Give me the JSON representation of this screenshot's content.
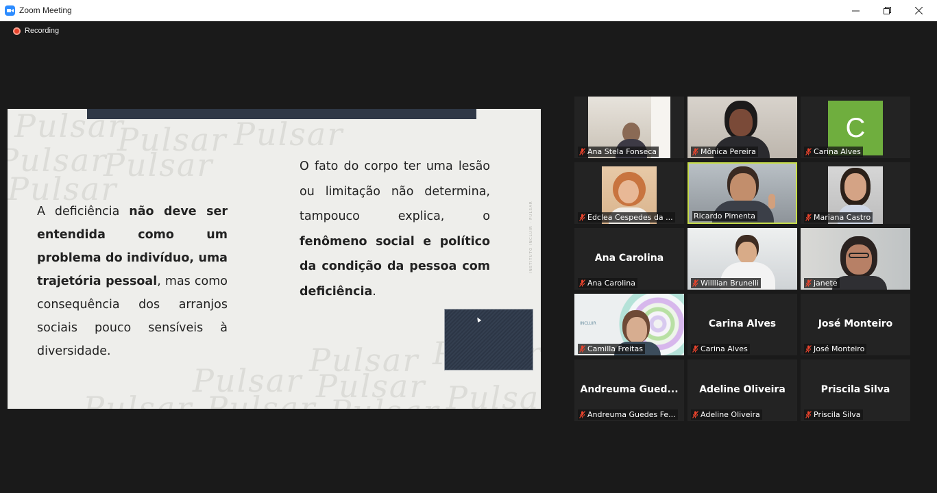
{
  "window": {
    "title": "Zoom Meeting",
    "icon": "zoom-camera-icon",
    "controls": [
      "minimize-icon",
      "restore-icon",
      "close-icon"
    ]
  },
  "recording": {
    "label": "Recording",
    "color": "#e8432c"
  },
  "slide": {
    "watermark": "Pulsar",
    "vertical_text": "INSTITUTO INCLUIR · PULSAR",
    "left_paragraph": [
      {
        "text": "A deficiência ",
        "bold": false
      },
      {
        "text": "não deve ser entendida como um problema do indivíduo, uma trajetória pessoal",
        "bold": true
      },
      {
        "text": ", mas como consequência dos arranjos sociais pouco sensíveis à diversidade.",
        "bold": false
      }
    ],
    "right_paragraph": [
      {
        "text": "O fato do corpo ter uma lesão ou limitação não determina, tampouco explica, o ",
        "bold": false
      },
      {
        "text": "fenômeno social e político da condição da pessoa com deficiência",
        "bold": true
      },
      {
        "text": ".",
        "bold": false
      }
    ]
  },
  "participants": [
    {
      "label": "Ana Stela Fonseca",
      "muted": true,
      "video": true,
      "active": false
    },
    {
      "label": "Mônica Pereira",
      "muted": true,
      "video": true,
      "active": false
    },
    {
      "label": "Carina Alves",
      "muted": true,
      "video": false,
      "avatar_letter": "C",
      "avatar_color": "#6fae3e",
      "active": false
    },
    {
      "label": "Edclea Cespedes da ...",
      "muted": true,
      "video": true,
      "active": false
    },
    {
      "label": "Ricardo Pimenta",
      "muted": false,
      "video": true,
      "active": true
    },
    {
      "label": "Mariana Castro",
      "muted": true,
      "video": true,
      "active": false
    },
    {
      "label": "Ana Carolina",
      "display_name": "Ana Carolina",
      "muted": true,
      "video": false,
      "active": false
    },
    {
      "label": "Willlian Brunelli",
      "muted": true,
      "video": true,
      "active": false
    },
    {
      "label": "janete",
      "muted": true,
      "video": true,
      "active": false
    },
    {
      "label": "Camilla Freitas",
      "muted": true,
      "video": true,
      "active": false
    },
    {
      "label": "Carina Alves",
      "display_name": "Carina Alves",
      "muted": true,
      "video": false,
      "active": false
    },
    {
      "label": "José Monteiro",
      "display_name": "José Monteiro",
      "muted": true,
      "video": false,
      "active": false
    },
    {
      "label": "Andreuma Guedes Fe...",
      "display_name": "Andreuma  Gued...",
      "muted": true,
      "video": false,
      "active": false
    },
    {
      "label": "Adeline Oliveira",
      "display_name": "Adeline Oliveira",
      "muted": true,
      "video": false,
      "active": false
    },
    {
      "label": "Priscila Silva",
      "display_name": "Priscila Silva",
      "muted": true,
      "video": false,
      "active": false
    }
  ],
  "colors": {
    "active_speaker": "#c7dd4a",
    "muted_icon": "#e8432c",
    "tile_bg": "#232323"
  }
}
